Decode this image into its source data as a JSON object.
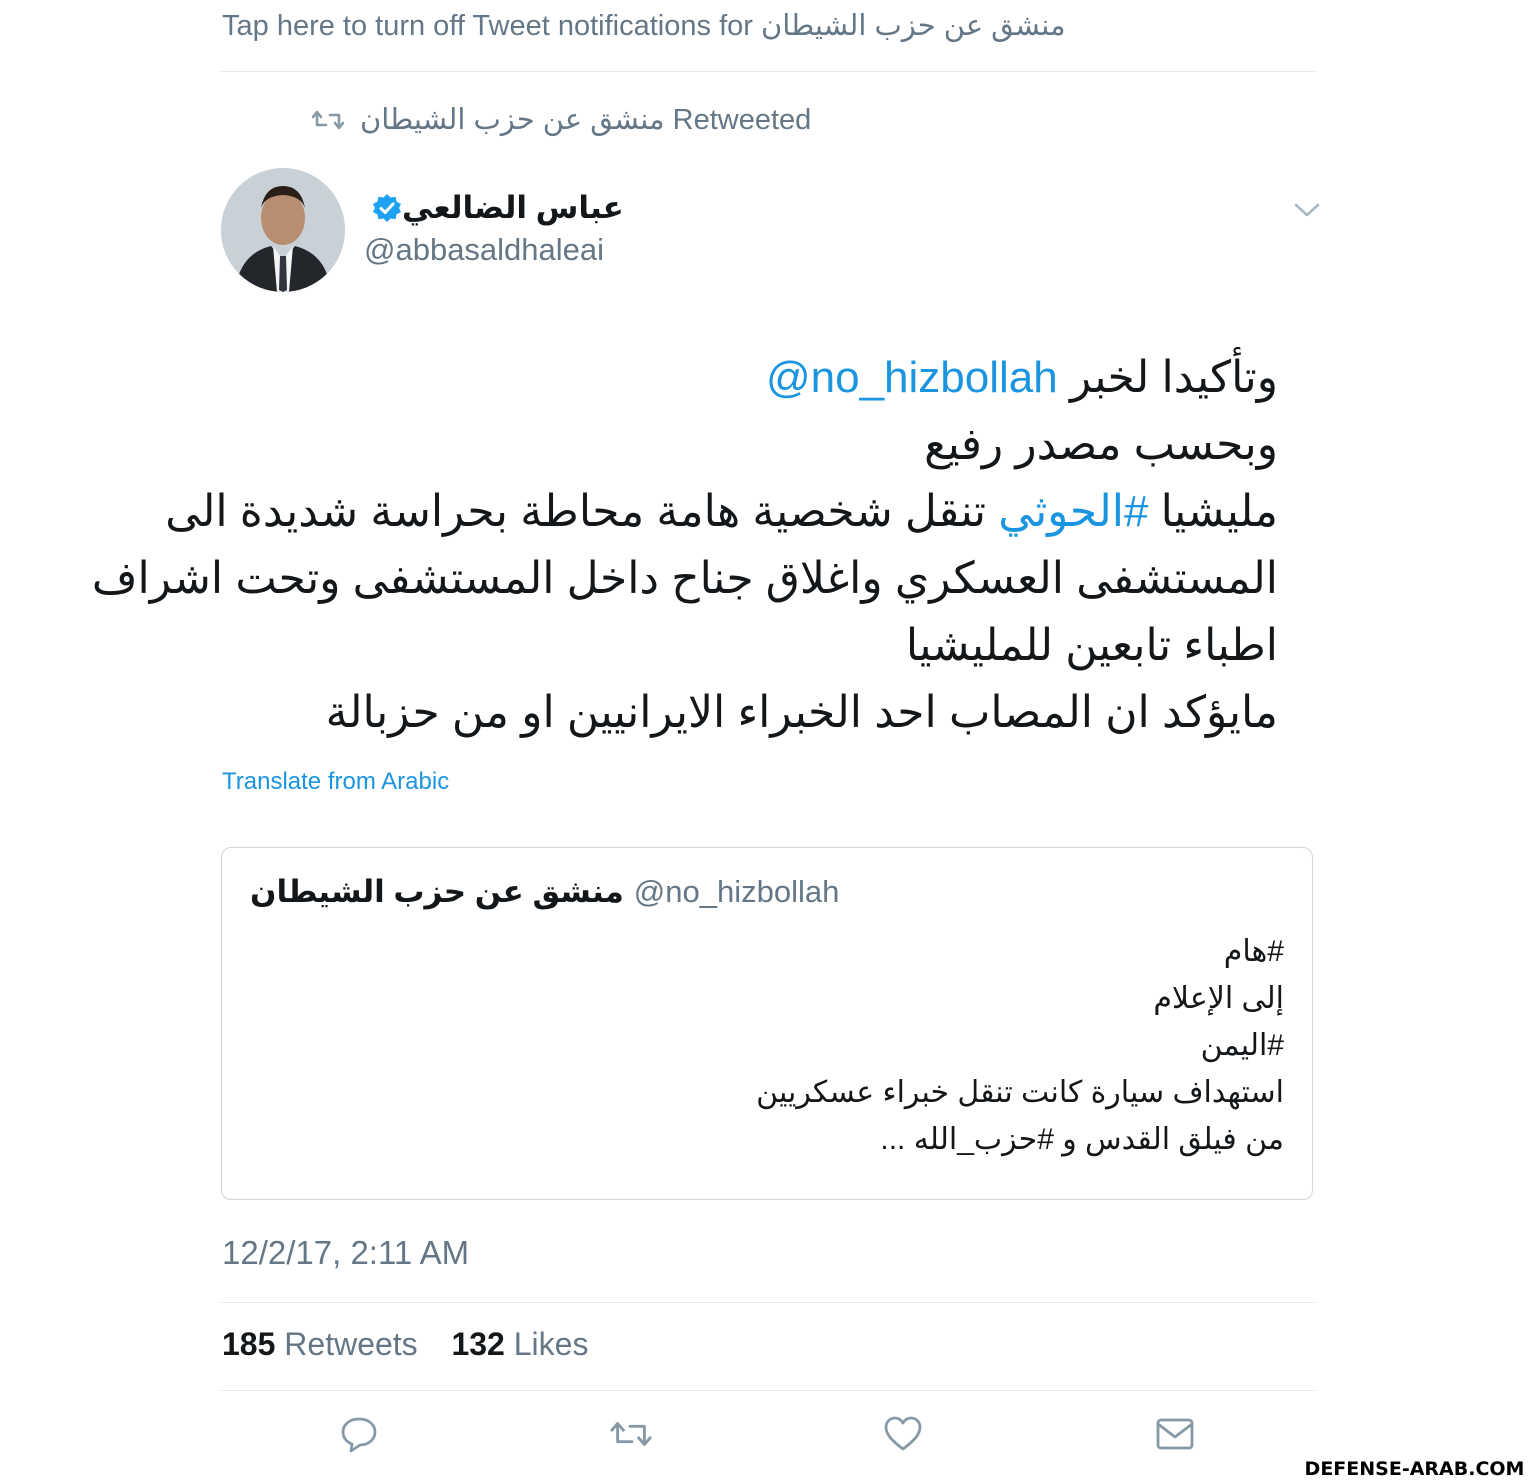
{
  "notification": {
    "text": "Tap here to turn off Tweet notifications for منشق عن حزب الشيطان"
  },
  "retweet": {
    "label": "منشق عن حزب الشيطان Retweeted"
  },
  "author": {
    "name": "عباس الضالعي",
    "handle": "@abbasaldhaleai",
    "verified": true
  },
  "tweet": {
    "line1_prefix": "وتأكيدا لخبر ",
    "line1_mention": "@no_hizbollah",
    "line2": "وبحسب مصدر رفيع",
    "line3_prefix": "مليشيا ",
    "line3_hashtag": "#الحوثي",
    "line3_suffix": " تنقل شخصية هامة محاطة بحراسة شديدة الى",
    "line4": "المستشفى العسكري واغلاق جناح داخل المستشفى وتحت اشراف",
    "line5": "اطباء تابعين للمليشيا",
    "line6": "مايؤكد ان المصاب احد الخبراء الايرانيين او من حزبالة",
    "translate_label": "Translate from Arabic"
  },
  "quoted_tweet": {
    "name": "منشق عن حزب الشيطان",
    "handle": "@no_hizbollah",
    "lines": [
      "#هام",
      "إلى الإعلام",
      "#اليمن",
      "استهداف سيارة كانت تنقل خبراء عسكريين",
      "من فيلق القدس و #حزب_الله ..."
    ]
  },
  "timestamp": "12/2/17, 2:11 AM",
  "stats": {
    "retweets_count": "185",
    "retweets_label": "Retweets",
    "likes_count": "132",
    "likes_label": "Likes"
  },
  "actions": {
    "icons": [
      "reply-icon",
      "retweet-icon",
      "like-icon",
      "direct-message-icon"
    ]
  },
  "watermark": "DEFENSE-ARAB.COM",
  "colors": {
    "link": "#1b95e0",
    "secondary_text": "#657786",
    "divider": "#e1e8ed",
    "primary_text": "#14171a"
  }
}
